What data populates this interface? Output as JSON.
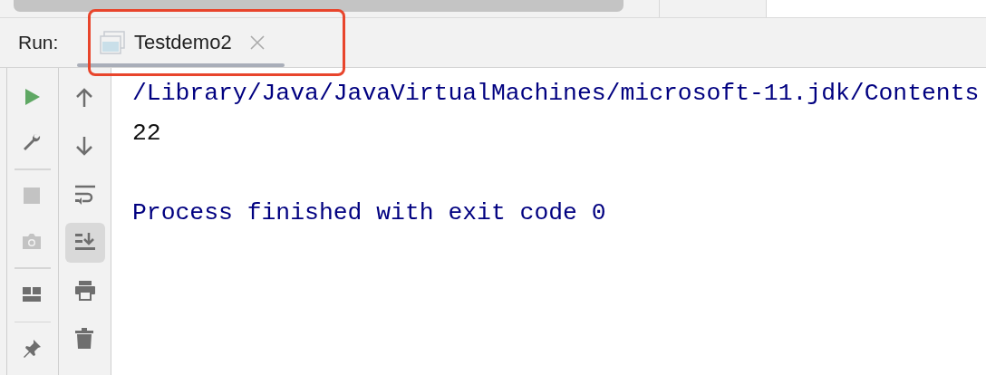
{
  "run_label": "Run:",
  "tabs": [
    {
      "label": "Testdemo2",
      "selected": true,
      "highlighted": true
    }
  ],
  "left_tools": [
    {
      "kind": "run",
      "disabled": false
    },
    {
      "kind": "wrench",
      "disabled": false
    },
    {
      "kind": "separator"
    },
    {
      "kind": "stop",
      "disabled": true
    },
    {
      "kind": "camera",
      "disabled": true
    },
    {
      "kind": "separator"
    },
    {
      "kind": "layout",
      "disabled": false
    },
    {
      "kind": "separator"
    },
    {
      "kind": "pin",
      "disabled": false
    }
  ],
  "right_tools": [
    {
      "kind": "up",
      "selected": false
    },
    {
      "kind": "down",
      "selected": false
    },
    {
      "kind": "wrap",
      "selected": false
    },
    {
      "kind": "scroll-end",
      "selected": true
    },
    {
      "kind": "print",
      "selected": false
    },
    {
      "kind": "trash",
      "selected": false
    }
  ],
  "console": [
    {
      "kind": "system",
      "text": "/Library/Java/JavaVirtualMachines/microsoft-11.jdk/Contents"
    },
    {
      "kind": "output",
      "text": "22"
    },
    {
      "kind": "blank"
    },
    {
      "kind": "system",
      "text": "Process finished with exit code 0"
    }
  ]
}
